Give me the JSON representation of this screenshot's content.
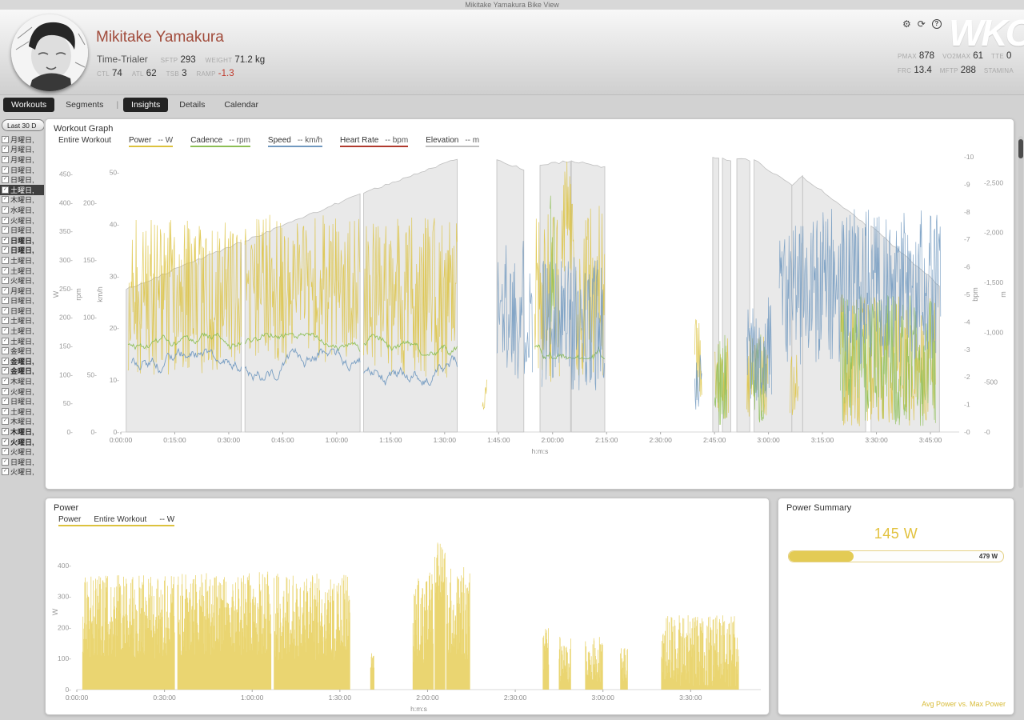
{
  "window": {
    "title": "Mikitake Yamakura Bike View"
  },
  "colors": {
    "power": "#dcc23e",
    "cadence": "#8cbe55",
    "speed": "#7199c0",
    "heart_rate": "#b03a2e",
    "elevation": "#bfbfbf",
    "elevation_fill": "#e9e9e9",
    "accent_name": "#a14b3b",
    "negative": "#c0392b"
  },
  "header": {
    "athlete_name": "Mikitake Yamakura",
    "athlete_type": "Time-Trialer",
    "logo": "WKO",
    "stats_row1": [
      {
        "label": "SFTP",
        "value": "293"
      },
      {
        "label": "WEIGHT",
        "value": "71.2 kg"
      }
    ],
    "stats_row2": [
      {
        "label": "CTL",
        "value": "74"
      },
      {
        "label": "ATL",
        "value": "62"
      },
      {
        "label": "TSB",
        "value": "3"
      },
      {
        "label": "RAMP",
        "value": "-1.3",
        "negative": true
      }
    ],
    "right_stats_row1": [
      {
        "label": "PMAX",
        "value": "878"
      },
      {
        "label": "VO2MAX",
        "value": "61"
      },
      {
        "label": "TTE",
        "value": "0"
      }
    ],
    "right_stats_row2": [
      {
        "label": "FRC",
        "value": "13.4"
      },
      {
        "label": "MFTP",
        "value": "288"
      },
      {
        "label": "STAMINA",
        "value": ""
      }
    ]
  },
  "tabs": [
    {
      "label": "Workouts",
      "active": true
    },
    {
      "label": "Segments"
    },
    {
      "divider": true
    },
    {
      "label": "Insights",
      "active": true
    },
    {
      "label": "Details"
    },
    {
      "label": "Calendar"
    }
  ],
  "sidebar": {
    "filter_button": "Last 30 D",
    "items": [
      {
        "label": "月曜日,"
      },
      {
        "label": "月曜日,"
      },
      {
        "label": "月曜日,"
      },
      {
        "label": "日曜日,"
      },
      {
        "label": "日曜日,"
      },
      {
        "label": "土曜日,",
        "selected": true
      },
      {
        "label": "木曜日,"
      },
      {
        "label": "水曜日,"
      },
      {
        "label": "火曜日,"
      },
      {
        "label": "日曜日,"
      },
      {
        "label": "日曜日,",
        "bold": true
      },
      {
        "label": "日曜日,",
        "bold": true
      },
      {
        "label": "土曜日,"
      },
      {
        "label": "土曜日,"
      },
      {
        "label": "火曜日,"
      },
      {
        "label": "月曜日,"
      },
      {
        "label": "日曜日,"
      },
      {
        "label": "日曜日,"
      },
      {
        "label": "土曜日,"
      },
      {
        "label": "土曜日,"
      },
      {
        "label": "土曜日,"
      },
      {
        "label": "金曜日,"
      },
      {
        "label": "金曜日,",
        "bold": true
      },
      {
        "label": "金曜日,",
        "bold": true
      },
      {
        "label": "木曜日,"
      },
      {
        "label": "火曜日,"
      },
      {
        "label": "日曜日,"
      },
      {
        "label": "土曜日,"
      },
      {
        "label": "木曜日,"
      },
      {
        "label": "木曜日,",
        "bold": true
      },
      {
        "label": "火曜日,",
        "bold": true
      },
      {
        "label": "火曜日,"
      },
      {
        "label": "日曜日,"
      },
      {
        "label": "火曜日,"
      }
    ]
  },
  "workout_graph": {
    "title": "Workout Graph",
    "legend": [
      {
        "label": "Entire Workout",
        "unit": "",
        "color": ""
      },
      {
        "label": "Power",
        "unit": "-- W",
        "color": "#dcc23e"
      },
      {
        "label": "Cadence",
        "unit": "-- rpm",
        "color": "#8cbe55"
      },
      {
        "label": "Speed",
        "unit": "-- km/h",
        "color": "#7199c0"
      },
      {
        "label": "Heart Rate",
        "unit": "-- bpm",
        "color": "#b03a2e"
      },
      {
        "label": "Elevation",
        "unit": "-- m",
        "color": "#bfbfbf"
      }
    ]
  },
  "power_panel": {
    "title": "Power",
    "legend": [
      {
        "label": "Power"
      },
      {
        "label": "Entire Workout"
      },
      {
        "label": "-- W"
      }
    ]
  },
  "power_summary": {
    "title": "Power Summary",
    "value": "145 W",
    "avg_w": 145,
    "max_w": 479,
    "max_label": "479 W",
    "caption": "Avg Power vs. Max Power"
  },
  "chart_data": [
    {
      "type": "line",
      "title": "Workout Graph",
      "x": {
        "title": "h:m:s",
        "tick_labels": [
          "0:00:00",
          "0:15:00",
          "0:30:00",
          "0:45:00",
          "1:00:00",
          "1:15:00",
          "1:30:00",
          "1:45:00",
          "2:00:00",
          "2:15:00",
          "2:30:00",
          "2:45:00",
          "3:00:00",
          "3:15:00",
          "3:30:00",
          "3:45:00"
        ],
        "tick_minutes": [
          0,
          15,
          30,
          45,
          60,
          75,
          90,
          105,
          120,
          135,
          150,
          165,
          180,
          195,
          210,
          225
        ],
        "max": 233
      },
      "left_axes": [
        {
          "title": "W",
          "max": 480,
          "ticks": [
            0,
            50,
            100,
            150,
            200,
            250,
            300,
            350,
            400,
            450
          ]
        },
        {
          "title": "rpm",
          "max": 240,
          "ticks": [
            0,
            50,
            100,
            150,
            200
          ]
        },
        {
          "title": "km/h",
          "max": 53,
          "ticks": [
            0,
            10,
            20,
            30,
            40,
            50
          ]
        }
      ],
      "right_axes": [
        {
          "title": "bpm",
          "max": 10,
          "ticks": [
            0,
            1,
            2,
            3,
            4,
            5,
            6,
            7,
            8,
            9,
            10
          ]
        },
        {
          "title": "m",
          "max": 2760,
          "ticks": [
            0,
            500,
            1000,
            1500,
            2000,
            2500
          ],
          "comma": true
        }
      ],
      "series": [
        {
          "name": "Elevation",
          "axis": "m",
          "color": "#bfbfbf",
          "fill": "#e9e9e9",
          "segments": [
            {
              "t0": 1.5,
              "t1": 33.5,
              "a": 1430,
              "b": 1905,
              "mode": "ramp"
            },
            {
              "t0": 34.5,
              "t1": 66.5,
              "a": 1915,
              "b": 2385,
              "mode": "ramp"
            },
            {
              "t0": 67.5,
              "t1": 93.5,
              "a": 2395,
              "b": 2745,
              "mode": "ramp"
            },
            {
              "t0": 104.5,
              "t1": 112,
              "a": 2730,
              "b": 2635,
              "mode": "ramp"
            },
            {
              "t0": 116.5,
              "t1": 125,
              "a": 2675,
              "b": 2720,
              "mode": "ramp"
            },
            {
              "t0": 125.2,
              "t1": 134.5,
              "a": 2720,
              "b": 2655,
              "mode": "ramp"
            },
            {
              "t0": 164.5,
              "t1": 166.2,
              "a": 2755,
              "b": 2745,
              "mode": "ramp"
            },
            {
              "t0": 167.2,
              "t1": 169.5,
              "a": 2748,
              "b": 2725,
              "mode": "ramp"
            },
            {
              "t0": 171.2,
              "t1": 174.8,
              "a": 2740,
              "b": 2725,
              "mode": "ramp"
            },
            {
              "t0": 176,
              "t1": 186.5,
              "a": 2730,
              "b": 2470,
              "mode": "ramp"
            },
            {
              "t0": 186.5,
              "t1": 189.5,
              "a": 2470,
              "b": 2560,
              "mode": "ramp"
            },
            {
              "t0": 189.5,
              "t1": 207,
              "a": 2560,
              "b": 2085,
              "mode": "ramp"
            },
            {
              "t0": 208.5,
              "t1": 227.5,
              "a": 2065,
              "b": 1470,
              "mode": "ramp"
            }
          ]
        },
        {
          "name": "Power",
          "axis": "W",
          "color": "#dcc23e",
          "segments": [
            {
              "t0": 2,
              "t1": 33.5,
              "a": 235,
              "b": 135,
              "mode": "spikes"
            },
            {
              "t0": 34.5,
              "t1": 66.5,
              "a": 245,
              "b": 135,
              "mode": "spikes"
            },
            {
              "t0": 67.5,
              "t1": 93.5,
              "a": 235,
              "b": 140,
              "mode": "spikes"
            },
            {
              "t0": 100.5,
              "t1": 101.8,
              "a": 70,
              "b": 50,
              "mode": "spikes"
            },
            {
              "t0": 115,
              "t1": 122,
              "a": 235,
              "b": 150,
              "mode": "spikes"
            },
            {
              "t0": 122.5,
              "t1": 126,
              "a": 380,
              "b": 100,
              "mode": "spikes"
            },
            {
              "t0": 126.5,
              "t1": 134.5,
              "a": 245,
              "b": 150,
              "mode": "spikes"
            },
            {
              "t0": 159.5,
              "t1": 161.5,
              "a": 120,
              "b": 80,
              "mode": "spikes"
            },
            {
              "t0": 165,
              "t1": 169,
              "a": 95,
              "b": 75,
              "mode": "spikes"
            },
            {
              "t0": 174,
              "t1": 180,
              "a": 95,
              "b": 75,
              "mode": "spikes"
            },
            {
              "t0": 186,
              "t1": 188.5,
              "a": 80,
              "b": 55,
              "mode": "spikes"
            },
            {
              "t0": 200,
              "t1": 226.5,
              "a": 125,
              "b": 115,
              "mode": "spikes"
            }
          ]
        },
        {
          "name": "Cadence",
          "axis": "rpm",
          "color": "#8cbe55",
          "segments": [
            {
              "t0": 2,
              "t1": 33.5,
              "a": 78,
              "b": 8,
              "mode": "line"
            },
            {
              "t0": 34.5,
              "t1": 66.5,
              "a": 78,
              "b": 8,
              "mode": "line"
            },
            {
              "t0": 67.5,
              "t1": 93.5,
              "a": 76,
              "b": 9,
              "mode": "line"
            },
            {
              "t0": 119.3,
              "t1": 120.6,
              "a": 160,
              "b": 80,
              "mode": "spikes"
            },
            {
              "t0": 115,
              "t1": 134.5,
              "a": 74,
              "b": 10,
              "mode": "line"
            },
            {
              "t0": 165,
              "t1": 168.5,
              "a": 45,
              "b": 40,
              "mode": "spikes"
            },
            {
              "t0": 175,
              "t1": 179.5,
              "a": 45,
              "b": 40,
              "mode": "spikes"
            },
            {
              "t0": 200,
              "t1": 226.5,
              "a": 62,
              "b": 58,
              "mode": "spikes"
            }
          ]
        },
        {
          "name": "Speed",
          "axis": "km/h",
          "color": "#7199c0",
          "segments": [
            {
              "t0": 3,
              "t1": 33.5,
              "a": 13,
              "b": 3,
              "mode": "line"
            },
            {
              "t0": 34.5,
              "t1": 66.5,
              "a": 13,
              "b": 3,
              "mode": "line"
            },
            {
              "t0": 67.5,
              "t1": 93.5,
              "a": 12,
              "b": 3,
              "mode": "line"
            },
            {
              "t0": 104.5,
              "t1": 114.5,
              "a": 24,
              "b": 14,
              "mode": "spikes"
            },
            {
              "t0": 117,
              "t1": 134.5,
              "a": 21,
              "b": 13,
              "mode": "spikes"
            },
            {
              "t0": 159.5,
              "t1": 161.5,
              "a": 9,
              "b": 6,
              "mode": "spikes"
            },
            {
              "t0": 174,
              "t1": 181,
              "a": 16,
              "b": 10,
              "mode": "spikes"
            },
            {
              "t0": 183,
              "t1": 228,
              "a": 28,
              "b": 15,
              "mode": "spikes"
            }
          ]
        }
      ]
    },
    {
      "type": "bar",
      "title": "Power",
      "x": {
        "title": "h:m:s",
        "tick_labels": [
          "0:00:00",
          "0:30:00",
          "1:00:00",
          "1:30:00",
          "2:00:00",
          "2:30:00",
          "3:00:00",
          "3:30:00"
        ],
        "tick_minutes": [
          0,
          30,
          60,
          90,
          120,
          150,
          180,
          210
        ],
        "max": 234
      },
      "left_axes": [
        {
          "title": "W",
          "max": 500,
          "ticks": [
            0,
            100,
            200,
            300,
            400
          ]
        }
      ],
      "right_axes": [],
      "series": [
        {
          "name": "Power",
          "axis": "W",
          "color": "#e5ca4e",
          "segments": [
            {
              "t0": 2,
              "t1": 33.5,
              "a": 235,
              "b": 135,
              "mode": "vbars"
            },
            {
              "t0": 34.5,
              "t1": 66.5,
              "a": 245,
              "b": 135,
              "mode": "vbars"
            },
            {
              "t0": 67.5,
              "t1": 93.5,
              "a": 235,
              "b": 140,
              "mode": "vbars"
            },
            {
              "t0": 100.5,
              "t1": 101.8,
              "a": 70,
              "b": 50,
              "mode": "vbars"
            },
            {
              "t0": 115,
              "t1": 122,
              "a": 235,
              "b": 150,
              "mode": "vbars"
            },
            {
              "t0": 122.5,
              "t1": 126,
              "a": 380,
              "b": 100,
              "mode": "vbars"
            },
            {
              "t0": 126.5,
              "t1": 134.5,
              "a": 245,
              "b": 150,
              "mode": "vbars"
            },
            {
              "t0": 159.5,
              "t1": 161.5,
              "a": 120,
              "b": 80,
              "mode": "vbars"
            },
            {
              "t0": 165,
              "t1": 169,
              "a": 95,
              "b": 75,
              "mode": "vbars"
            },
            {
              "t0": 174,
              "t1": 180,
              "a": 95,
              "b": 75,
              "mode": "vbars"
            },
            {
              "t0": 186,
              "t1": 188.5,
              "a": 80,
              "b": 55,
              "mode": "vbars"
            },
            {
              "t0": 200,
              "t1": 226.5,
              "a": 125,
              "b": 115,
              "mode": "vbars"
            }
          ]
        }
      ]
    }
  ]
}
